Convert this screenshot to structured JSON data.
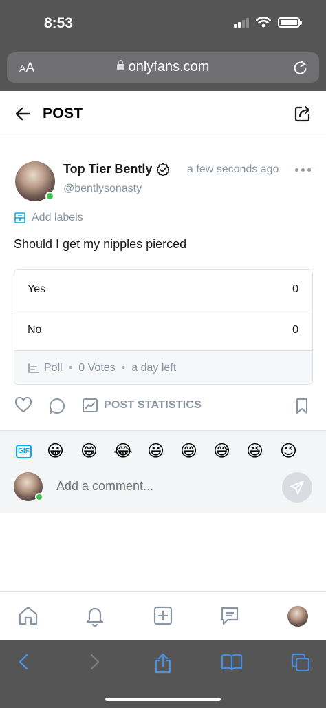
{
  "status_bar": {
    "time": "8:53"
  },
  "browser": {
    "aa_label_small": "A",
    "aa_label_large": "A",
    "url": "onlyfans.com"
  },
  "header": {
    "title": "POST"
  },
  "post": {
    "author_name": "Top Tier Bently",
    "handle": "@bentlysonasty",
    "time": "a few seconds ago",
    "add_labels": "Add labels",
    "text": "Should I get my nipples pierced",
    "poll": {
      "options": [
        {
          "label": "Yes",
          "count": "0"
        },
        {
          "label": "No",
          "count": "0"
        }
      ],
      "footer": {
        "type": "Poll",
        "votes": "0 Votes",
        "time_left": "a day left"
      }
    },
    "post_statistics_label": "POST STATISTICS"
  },
  "comment": {
    "gif_label": "GIF",
    "emojis": [
      "😀",
      "😁",
      "😂",
      "😃",
      "😄",
      "😅",
      "😆",
      "😉"
    ],
    "placeholder": "Add a comment..."
  },
  "colors": {
    "accent": "#00aff0",
    "muted": "#8a96a3",
    "online": "#3ec24f",
    "chrome": "#555556",
    "safari_blue": "#4a90e2"
  }
}
